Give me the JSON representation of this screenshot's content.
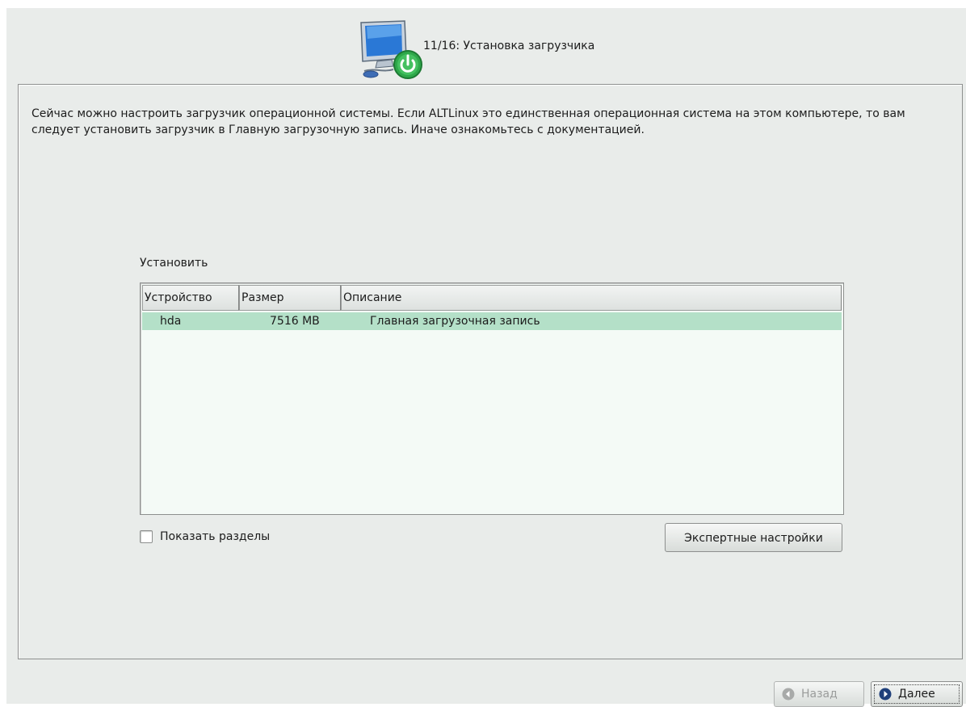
{
  "header": {
    "step_title": "11/16: Установка загрузчика",
    "icon": "computer-power-icon"
  },
  "intro_text": "Сейчас можно настроить загрузчик операционной системы. Если ALTLinux это единственная операционная система на этом компьютере, то вам следует установить загрузчик в Главную загрузочную запись. Иначе ознакомьтесь с документацией.",
  "install": {
    "label": "Установить",
    "columns": [
      "Устройство",
      "Размер",
      "Описание"
    ],
    "rows": [
      {
        "device": "hda",
        "size": "7516 MB",
        "description": "Главная загрузочная запись",
        "selected": true
      }
    ]
  },
  "show_partitions": {
    "label": "Показать разделы",
    "checked": false
  },
  "expert_button": {
    "label": "Экспертные настройки"
  },
  "footer": {
    "back_label": "Назад",
    "back_enabled": false,
    "back_icon": "arrow-left-circle-icon",
    "next_label": "Далее",
    "next_icon": "arrow-right-circle-icon"
  },
  "colors": {
    "background": "#e9ecea",
    "selection": "#b4e0c8",
    "accent_green": "#2ea84a"
  }
}
